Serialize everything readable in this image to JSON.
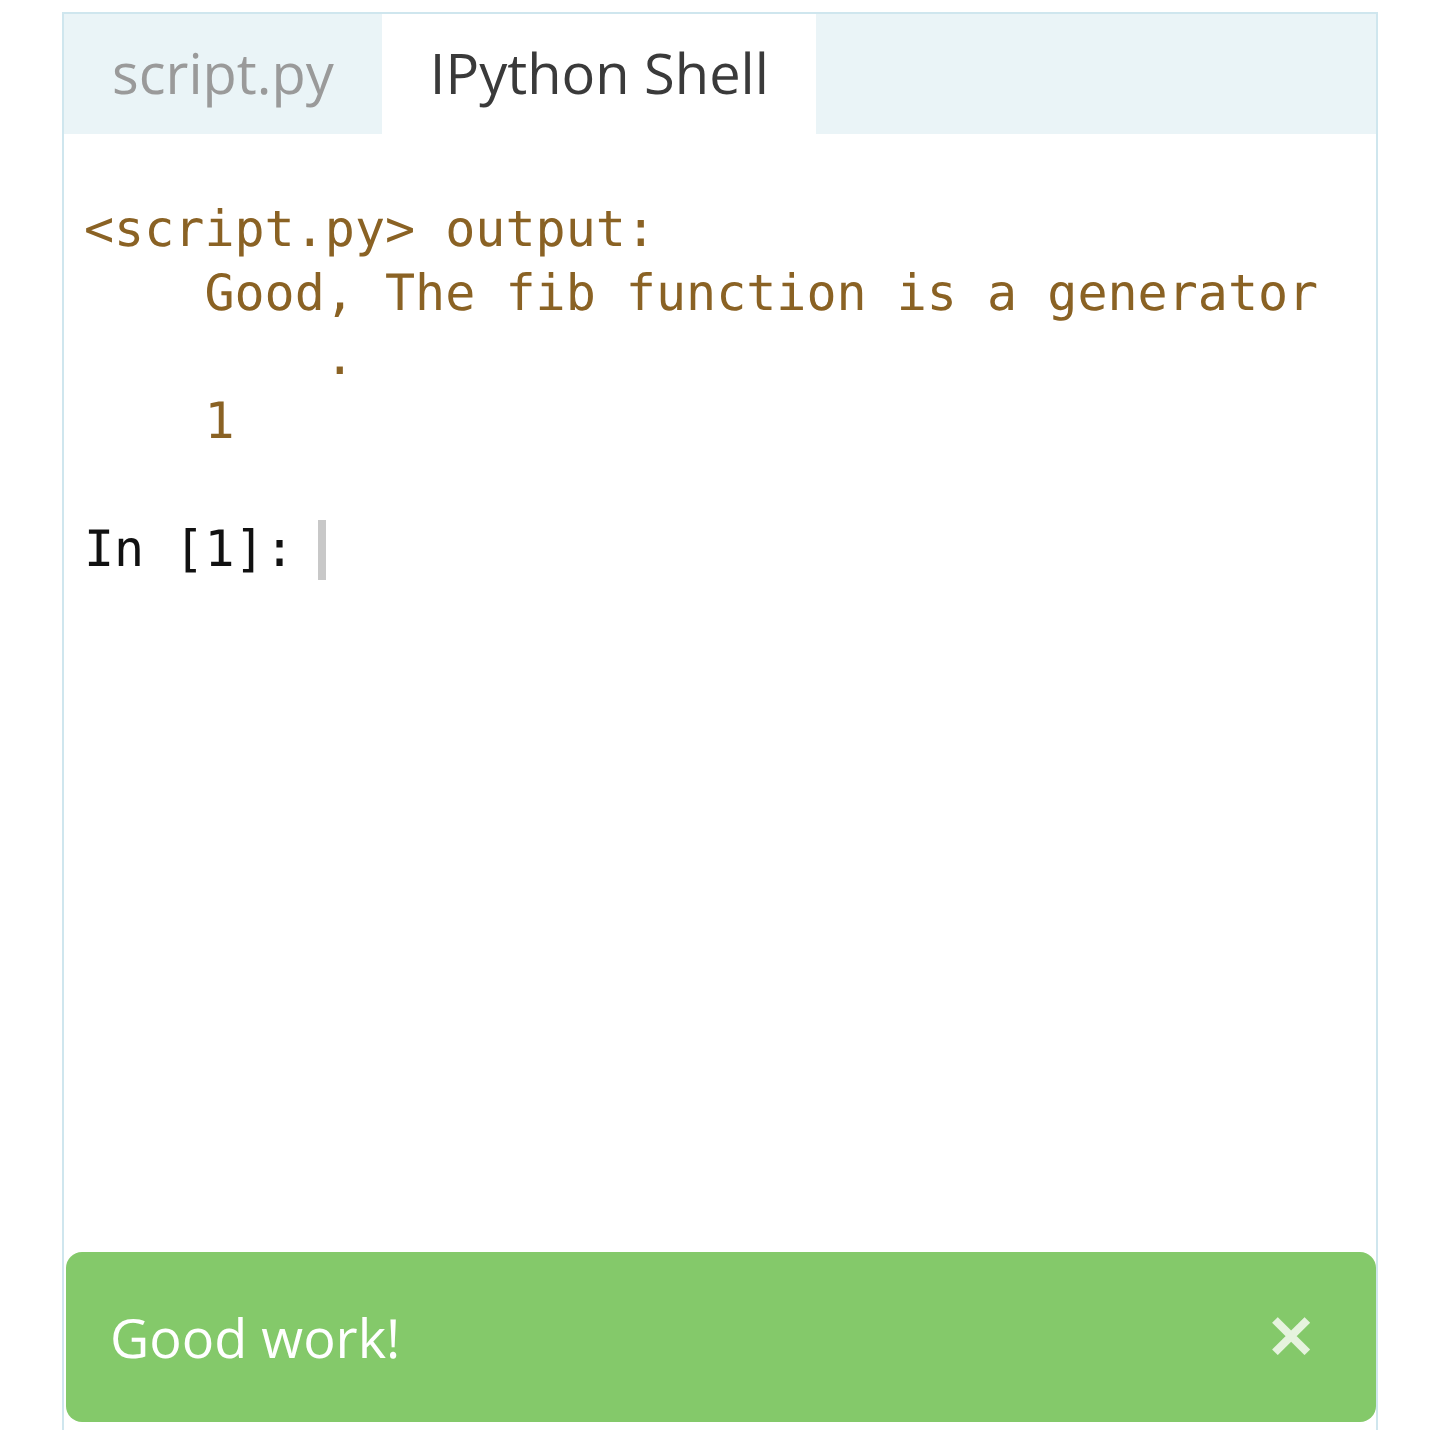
{
  "tabs": [
    {
      "label": "script.py",
      "selected": false
    },
    {
      "label": "IPython Shell",
      "selected": true
    }
  ],
  "console": {
    "header": "<script.py> output:",
    "lines": [
      {
        "text": "Good, The fib function is a generator",
        "kind": "line"
      },
      {
        "text": ".",
        "kind": "continuation"
      },
      {
        "text": "1",
        "kind": "line"
      }
    ],
    "prompt": "In [1]:"
  },
  "toast": {
    "message": "Good work!",
    "close": "✕"
  }
}
